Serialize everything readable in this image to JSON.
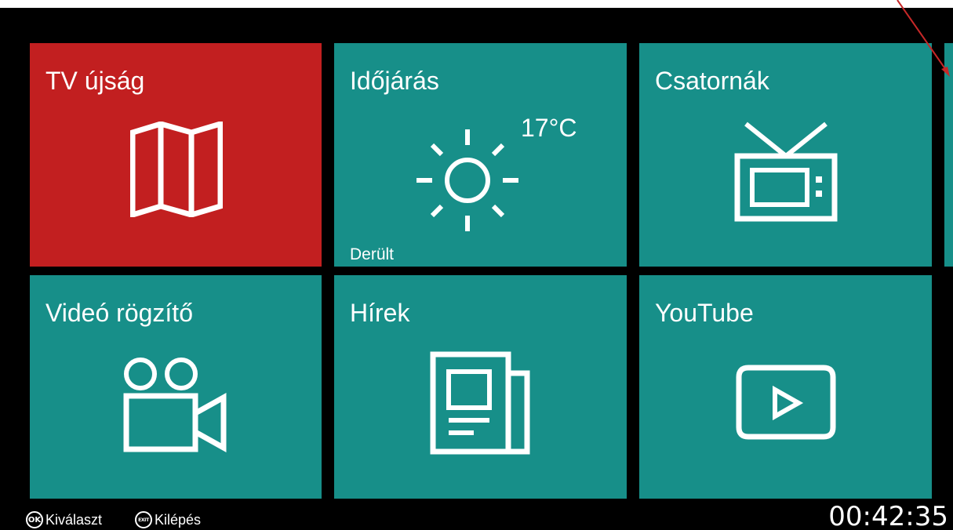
{
  "colors": {
    "teal": "#178f89",
    "red": "#c21f20",
    "background": "#000000",
    "annotation_arrow": "#c62828"
  },
  "tiles": [
    {
      "id": "tv-guide",
      "title": "TV újság",
      "icon": "map-icon",
      "color": "#c21f20",
      "selected": true
    },
    {
      "id": "weather",
      "title": "Időjárás",
      "icon": "sun-icon",
      "temperature": "17°C",
      "condition": "Derült",
      "color": "#178f89"
    },
    {
      "id": "channels",
      "title": "Csatornák",
      "icon": "tv-icon",
      "color": "#178f89"
    },
    {
      "id": "video-recorder",
      "title": "Videó rögzítő",
      "icon": "video-camera-icon",
      "color": "#178f89"
    },
    {
      "id": "news",
      "title": "Hírek",
      "icon": "newspaper-icon",
      "color": "#178f89"
    },
    {
      "id": "youtube",
      "title": "YouTube",
      "icon": "play-button-icon",
      "color": "#178f89"
    }
  ],
  "footer": {
    "ok_key": "OK",
    "ok_label": "Kiválaszt",
    "exit_key": "EXIT",
    "exit_label": "Kilépés",
    "clock": "00:42:35"
  }
}
